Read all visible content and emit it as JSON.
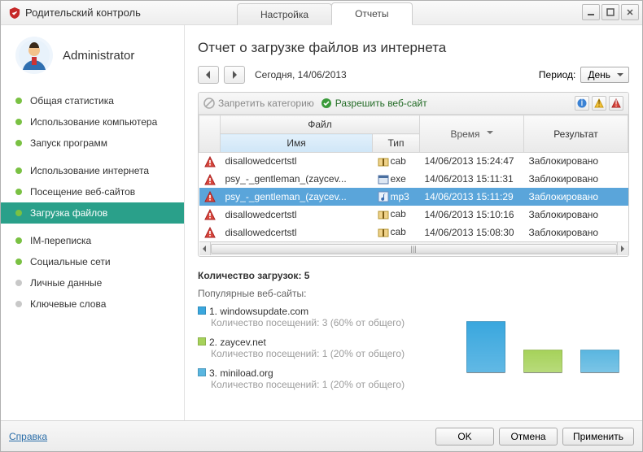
{
  "window": {
    "title": "Родительский контроль",
    "tabs": {
      "settings": "Настройка",
      "reports": "Отчеты",
      "active": "reports"
    },
    "controls": {
      "min": "—",
      "max": "☐",
      "close": "✕"
    }
  },
  "user": {
    "name": "Administrator"
  },
  "sidebar": {
    "items": [
      {
        "label": "Общая статистика",
        "state": "on"
      },
      {
        "label": "Использование компьютера",
        "state": "on"
      },
      {
        "label": "Запуск программ",
        "state": "on"
      },
      {
        "label": "Использование интернета",
        "state": "on",
        "gap_before": true
      },
      {
        "label": "Посещение веб-сайтов",
        "state": "on"
      },
      {
        "label": "Загрузка файлов",
        "state": "on",
        "active": true
      },
      {
        "label": "IM-переписка",
        "state": "on",
        "gap_before": true
      },
      {
        "label": "Социальные сети",
        "state": "on"
      },
      {
        "label": "Личные данные",
        "state": "off"
      },
      {
        "label": "Ключевые слова",
        "state": "off"
      }
    ]
  },
  "report": {
    "title": "Отчет о загрузке файлов из интернета",
    "date_label": "Сегодня, 14/06/2013",
    "period_label": "Период:",
    "period_value": "День"
  },
  "toolbar": {
    "deny": "Запретить категорию",
    "allow": "Разрешить веб-сайт"
  },
  "columns": {
    "file_group": "Файл",
    "name": "Имя",
    "type": "Тип",
    "time": "Время",
    "result": "Результат"
  },
  "rows": [
    {
      "name": "disallowedcertstl",
      "type": "cab",
      "ft": "archive",
      "time": "14/06/2013 15:24:47",
      "result": "Заблокировано"
    },
    {
      "name": "psy_-_gentleman_(zaycev...",
      "type": "exe",
      "ft": "exe",
      "time": "14/06/2013 15:11:31",
      "result": "Заблокировано"
    },
    {
      "name": "psy_-_gentleman_(zaycev...",
      "type": "mp3",
      "ft": "audio",
      "time": "14/06/2013 15:11:29",
      "result": "Заблокировано",
      "selected": true
    },
    {
      "name": "disallowedcertstl",
      "type": "cab",
      "ft": "archive",
      "time": "14/06/2013 15:10:16",
      "result": "Заблокировано"
    },
    {
      "name": "disallowedcertstl",
      "type": "cab",
      "ft": "archive",
      "time": "14/06/2013 15:08:30",
      "result": "Заблокировано"
    }
  ],
  "summary": {
    "count_label": "Количество загрузок: 5",
    "popular_label": "Популярные веб-сайты:",
    "sites": [
      {
        "idx": "1.",
        "domain": "windowsupdate.com",
        "detail": "Количество посещений: 3 (60% от общего)",
        "color": "#3aa7de"
      },
      {
        "idx": "2.",
        "domain": "zaycev.net",
        "detail": "Количество посещений: 1 (20% от общего)",
        "color": "#a6d25a"
      },
      {
        "idx": "3.",
        "domain": "miniload.org",
        "detail": "Количество посещений: 1 (20% от общего)",
        "color": "#5ab6e0"
      }
    ]
  },
  "chart_data": {
    "type": "bar",
    "categories": [
      "windowsupdate.com",
      "zaycev.net",
      "miniload.org"
    ],
    "values": [
      3,
      1,
      1
    ],
    "colors": [
      "#3aa7de",
      "#a6d25a",
      "#5ab6e0"
    ],
    "title": "",
    "xlabel": "",
    "ylabel": "",
    "ylim": [
      0,
      3
    ]
  },
  "footer": {
    "help": "Справка",
    "ok": "OK",
    "cancel": "Отмена",
    "apply": "Применить"
  },
  "icons": {
    "deny": "⦸",
    "allow": "✔",
    "info": "i",
    "warn": "!",
    "prev": "◀",
    "next": "▶",
    "scroll_grip": "|||"
  }
}
